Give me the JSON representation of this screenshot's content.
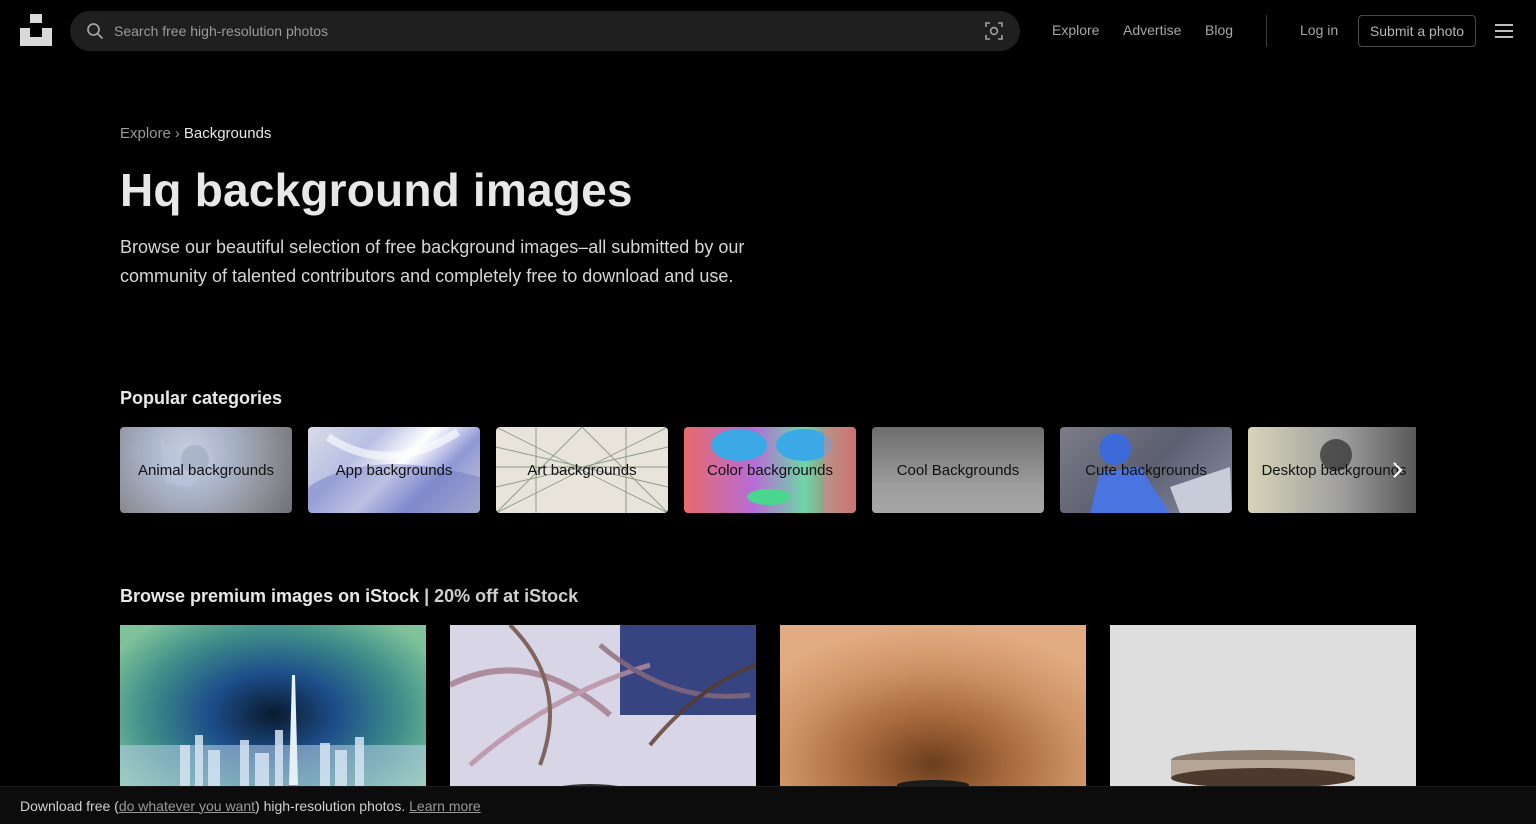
{
  "header": {
    "search_placeholder": "Search free high-resolution photos",
    "nav": {
      "explore": "Explore",
      "advertise": "Advertise",
      "blog": "Blog",
      "login": "Log in",
      "submit": "Submit a photo"
    },
    "icons": {
      "logo": "unsplash-logo-icon",
      "search": "search-icon",
      "visual_search": "visual-search-icon",
      "menu": "hamburger-menu-icon"
    }
  },
  "hero": {
    "breadcrumb": {
      "parent": "Explore",
      "separator": "›",
      "current": "Backgrounds"
    },
    "title": "Hq background images",
    "description": "Browse our beautiful selection of free background images–all submitted by our community of talented contributors and completely free to download and use."
  },
  "categories": {
    "title": "Popular categories",
    "items": [
      {
        "label": "Animal backgrounds"
      },
      {
        "label": "App backgrounds"
      },
      {
        "label": "Art backgrounds"
      },
      {
        "label": "Color backgrounds"
      },
      {
        "label": "Cool Backgrounds"
      },
      {
        "label": "Cute backgrounds"
      },
      {
        "label": "Desktop backgrounds"
      }
    ],
    "next_icon": "chevron-right-icon"
  },
  "istock": {
    "title_bold": "Browse premium images on iStock",
    "title_light": "| 20% off at iStock"
  },
  "bottom_bar": {
    "text_before": "Download free (",
    "link_license": "do whatever you want",
    "text_after": ") high-resolution photos.",
    "link_learn": "Learn more"
  },
  "colors": {
    "background": "#000000",
    "search_bg": "#1f1f1f",
    "text_primary": "#e8e8e8",
    "text_muted": "#9a9a9a"
  }
}
